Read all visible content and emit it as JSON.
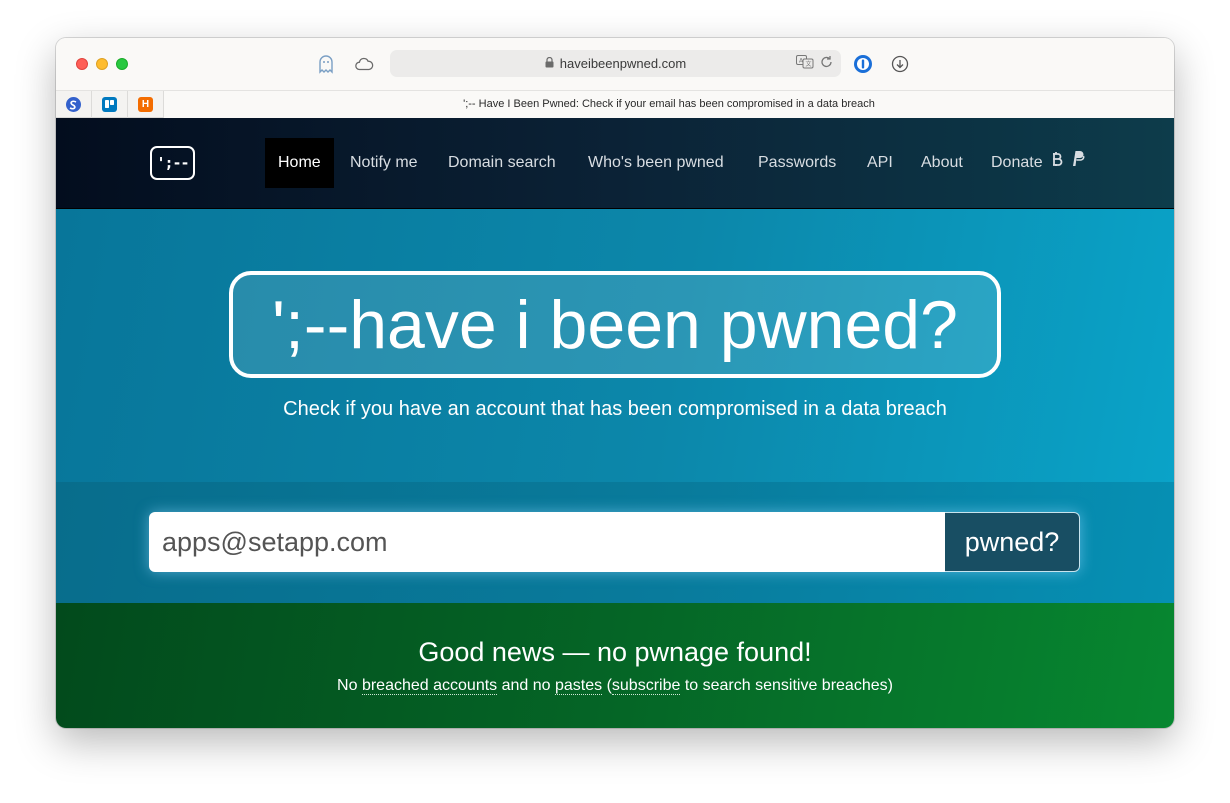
{
  "browser": {
    "url": "haveibeenpwned.com",
    "tab_title": "';-- Have I Been Pwned: Check if your email has been compromised in a data breach",
    "toolbar_icons": [
      "ghost-icon",
      "cloud-icon",
      "translate-icon",
      "reload-icon",
      "password-manager-icon",
      "download-icon"
    ],
    "pinned_tabs": [
      {
        "name": "simplenote",
        "color": "#3361cc",
        "glyph": "S"
      },
      {
        "name": "trello",
        "color": "#0079bf",
        "glyph": "▥"
      },
      {
        "name": "harvest",
        "color": "#f36c00",
        "glyph": "H"
      }
    ]
  },
  "site": {
    "logo": "';--",
    "nav": [
      {
        "label": "Home",
        "active": true
      },
      {
        "label": "Notify me"
      },
      {
        "label": "Domain search"
      },
      {
        "label": "Who's been pwned"
      },
      {
        "label": "Passwords"
      },
      {
        "label": "API"
      },
      {
        "label": "About"
      },
      {
        "label": "Donate"
      }
    ],
    "donate_icons": [
      "bitcoin-icon",
      "paypal-icon"
    ]
  },
  "hero": {
    "title": "';--have i been pwned?",
    "subtitle": "Check if you have an account that has been compromised in a data breach"
  },
  "search": {
    "value": "apps@setapp.com",
    "button_label": "pwned?"
  },
  "result": {
    "title": "Good news — no pwnage found!",
    "text_1": "No ",
    "link_breached": "breached accounts",
    "text_2": " and no ",
    "link_pastes": "pastes",
    "text_3": " (",
    "link_subscribe": "subscribe",
    "text_4": " to search sensitive breaches)"
  },
  "colors": {
    "nav_bg": "#0b2236",
    "hero_bg": "#0c87aa",
    "button_bg": "#184e63",
    "result_bg": "#056526"
  }
}
